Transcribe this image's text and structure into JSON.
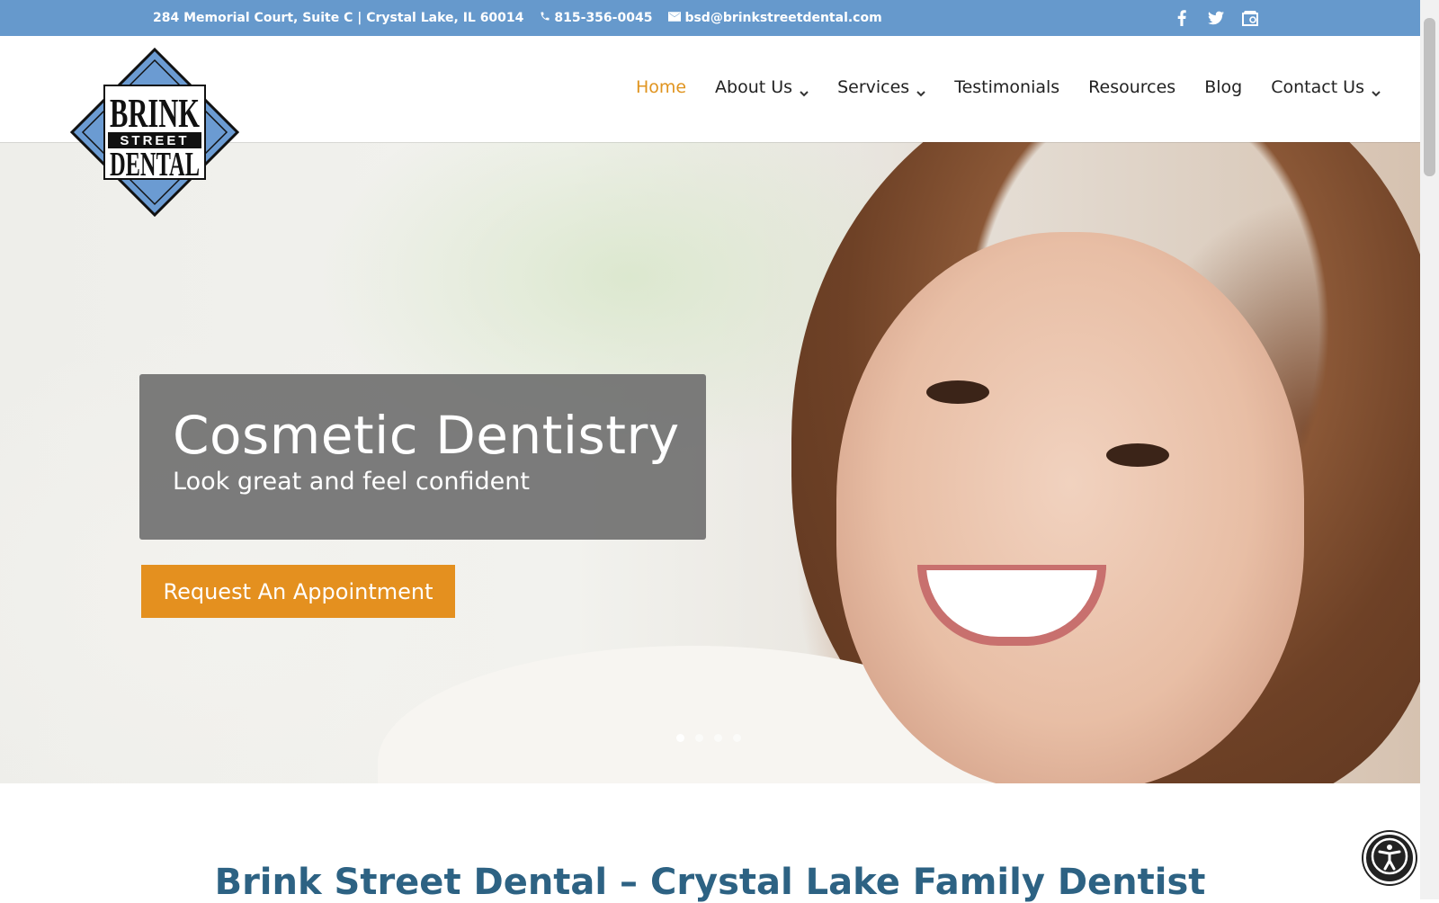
{
  "topbar": {
    "address": "284 Memorial Court, Suite C | Crystal Lake, IL 60014",
    "phone": "815-356-0045",
    "email": "bsd@brinkstreetdental.com",
    "social": [
      "facebook-icon",
      "twitter-icon",
      "google-my-business-icon"
    ]
  },
  "logo": {
    "line1": "BRINK",
    "line2": "STREET",
    "line3": "DENTAL"
  },
  "nav": {
    "items": [
      {
        "label": "Home",
        "active": true,
        "dropdown": false
      },
      {
        "label": "About Us",
        "active": false,
        "dropdown": true
      },
      {
        "label": "Services",
        "active": false,
        "dropdown": true
      },
      {
        "label": "Testimonials",
        "active": false,
        "dropdown": false
      },
      {
        "label": "Resources",
        "active": false,
        "dropdown": false
      },
      {
        "label": "Blog",
        "active": false,
        "dropdown": false
      },
      {
        "label": "Contact Us",
        "active": false,
        "dropdown": true
      }
    ]
  },
  "hero": {
    "title": "Cosmetic Dentistry",
    "subtitle": "Look great and feel confident",
    "cta_label": "Request An Appointment",
    "slide_count": 4,
    "active_slide": 1
  },
  "main": {
    "heading": "Brink Street Dental – Crystal Lake Family Dentist"
  },
  "colors": {
    "topbar": "#6699cc",
    "accent": "#e4901f",
    "heading": "#2d6283",
    "logo_blue": "#6b9bd2"
  }
}
